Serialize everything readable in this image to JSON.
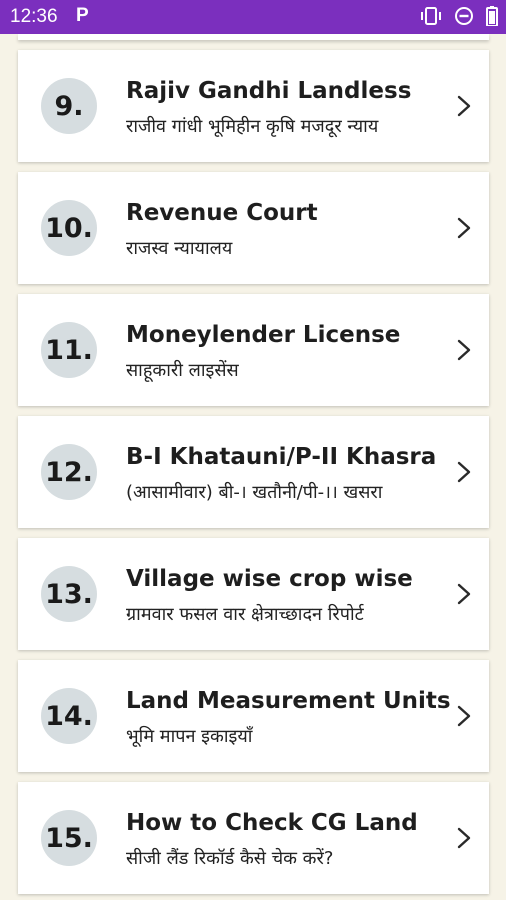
{
  "status_bar": {
    "time": "12:36",
    "app_indicator": "P",
    "icons": [
      "vibrate-icon",
      "do-not-disturb-icon",
      "battery-icon"
    ]
  },
  "colors": {
    "status_bar": "#7b2fbe",
    "background": "#f6f3e7",
    "card": "#ffffff",
    "number_circle": "#d6dde0"
  },
  "items": [
    {
      "number": "9.",
      "title": "Rajiv Gandhi Landless",
      "subtitle": "राजीव गांधी भूमिहीन कृषि मजदूर न्याय"
    },
    {
      "number": "10.",
      "title": "Revenue Court",
      "subtitle": "राजस्व न्यायालय"
    },
    {
      "number": "11.",
      "title": "Moneylender License",
      "subtitle": "साहूकारी लाइसेंस"
    },
    {
      "number": "12.",
      "title": "B-I Khatauni/P-II Khasra",
      "subtitle": "(आसामीवार) बी-। खतौनी/पी-।। खसरा"
    },
    {
      "number": "13.",
      "title": "Village wise crop wise",
      "subtitle": "ग्रामवार फसल वार क्षेत्राच्छादन रिपोर्ट"
    },
    {
      "number": "14.",
      "title": "Land Measurement Units",
      "subtitle": "भूमि मापन इकाइयाँ"
    },
    {
      "number": "15.",
      "title": "How to Check CG Land",
      "subtitle": "सीजी लैंड रिकॉर्ड कैसे चेक करें?"
    }
  ]
}
